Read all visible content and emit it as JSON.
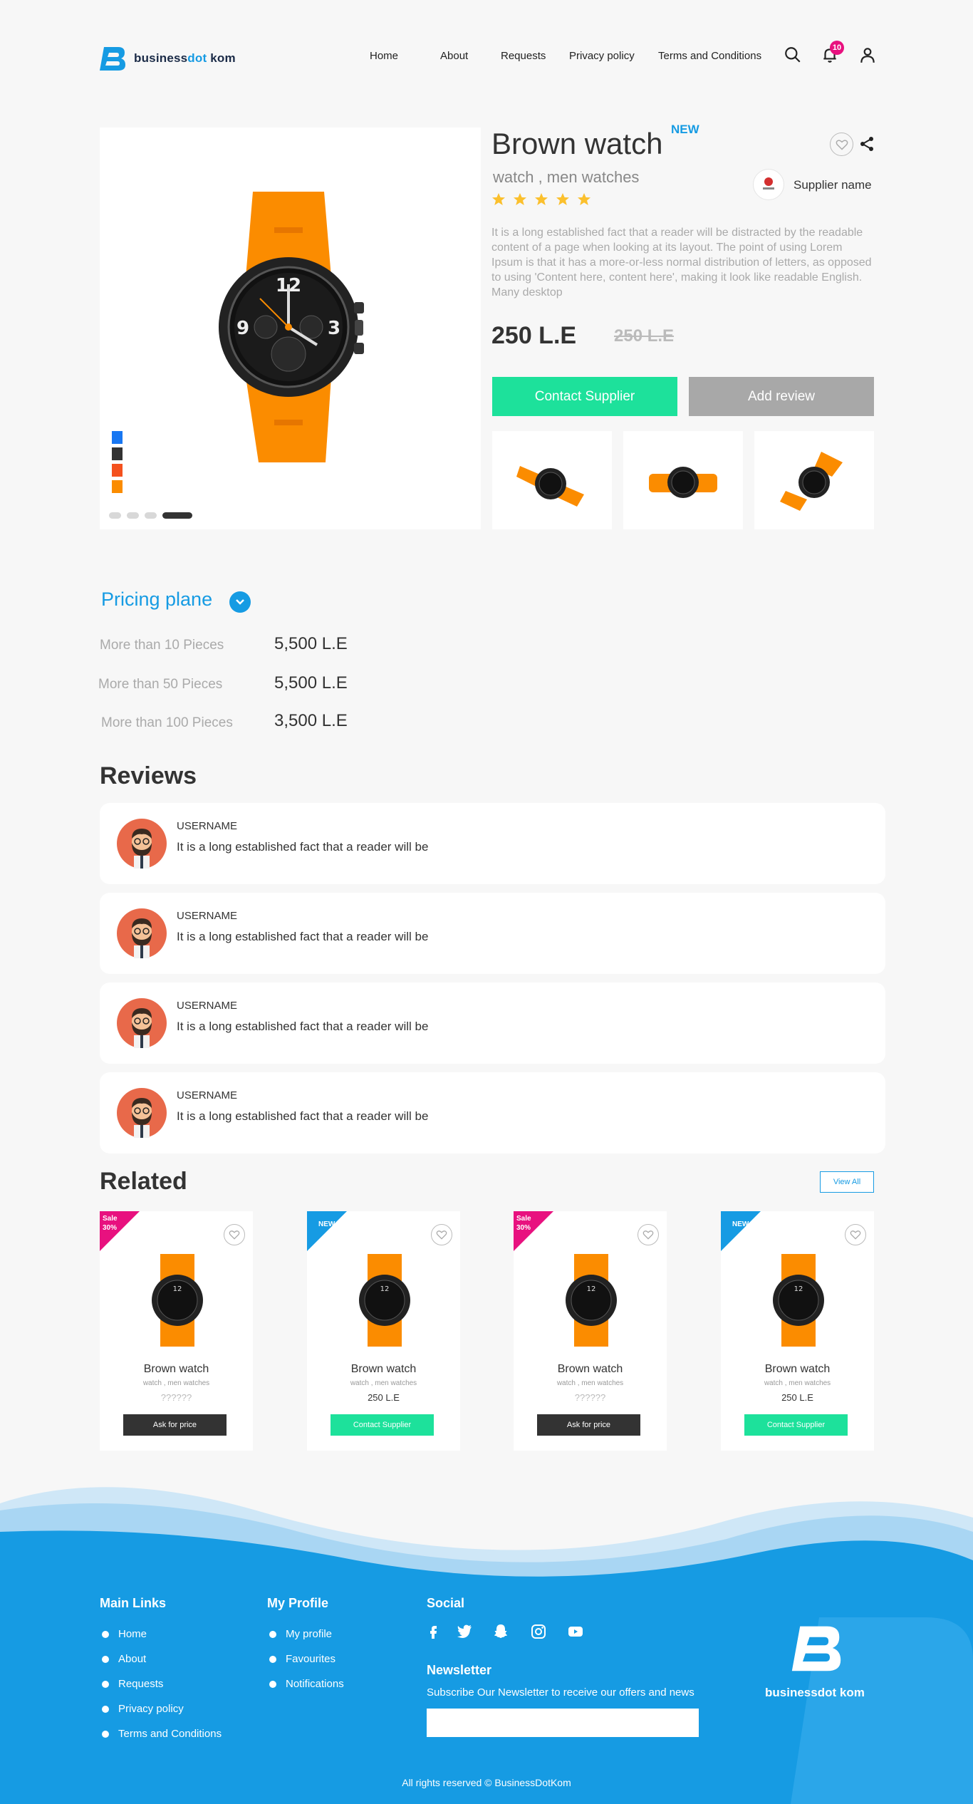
{
  "header": {
    "logo_word": "business",
    "logo_dot": "dot",
    "logo_word2": "kom",
    "nav": [
      "Home",
      "About",
      "Requests",
      "Privacy policy",
      "Terms and Conditions"
    ],
    "notification_count": "10",
    "icons": [
      "search-icon",
      "bell-icon",
      "user-icon"
    ]
  },
  "product": {
    "title": "Brown watch",
    "new_tag": "NEW",
    "subtitle": "watch , men watches",
    "rating": 5,
    "rating_max": 5,
    "supplier_name": "Supplier name",
    "description": "It is a long established fact that a reader will be distracted by the readable content of a page when looking at its layout. The point of using Lorem Ipsum is that it has a more-or-less normal distribution of letters, as opposed to using 'Content here, content here', making it look like readable English. Many desktop",
    "price": "250 L.E",
    "old_price": "250 L.E",
    "contact_label": "Contact Supplier",
    "review_label": "Add review",
    "swatches": [
      "#1877f2",
      "#333333",
      "#f4511e",
      "#fb8c00"
    ],
    "gallery_active_index": 4,
    "gallery_count": 4
  },
  "pricing": {
    "title": "Pricing plane",
    "rows": [
      {
        "label": "More than 10 Pieces",
        "value": "5,500 L.E"
      },
      {
        "label": "More than 50 Pieces",
        "value": "5,500 L.E"
      },
      {
        "label": "More than 100 Pieces",
        "value": "3,500 L.E"
      }
    ]
  },
  "reviews": {
    "title": "Reviews",
    "items": [
      {
        "user": "USERNAME",
        "text": "It is a long established fact that a reader will be"
      },
      {
        "user": "USERNAME",
        "text": "It is a long established fact that a reader will be"
      },
      {
        "user": "USERNAME",
        "text": "It is a long established fact that a reader will be"
      },
      {
        "user": "USERNAME",
        "text": "It is a long established fact that a reader will be"
      }
    ]
  },
  "related": {
    "title": "Related",
    "view_all": "View All",
    "items": [
      {
        "tag": "Sale",
        "tag_value": "30%",
        "tag_color": "#e8117f",
        "title": "Brown watch",
        "sub": "watch , men watches",
        "price": "??????",
        "button": "Ask for price",
        "button_color": "#333333"
      },
      {
        "tag": "NEW",
        "tag_value": "",
        "tag_color": "#169be3",
        "title": "Brown watch",
        "sub": "watch , men watches",
        "price": "250 L.E",
        "button": "Contact Supplier",
        "button_color": "#1de19b"
      },
      {
        "tag": "Sale",
        "tag_value": "30%",
        "tag_color": "#e8117f",
        "title": "Brown watch",
        "sub": "watch , men watches",
        "price": "??????",
        "button": "Ask for price",
        "button_color": "#333333"
      },
      {
        "tag": "NEW",
        "tag_value": "",
        "tag_color": "#169be3",
        "title": "Brown watch",
        "sub": "watch , men watches",
        "price": "250 L.E",
        "button": "Contact Supplier",
        "button_color": "#1de19b"
      }
    ]
  },
  "footer": {
    "main_links_title": "Main Links",
    "main_links": [
      "Home",
      "About",
      "Requests",
      "Privacy policy",
      "Terms and Conditions"
    ],
    "profile_title": "My Profile",
    "profile_links": [
      "My profile",
      "Favourites",
      "Notifications"
    ],
    "social_title": "Social",
    "social_icons": [
      "facebook-icon",
      "twitter-icon",
      "snapchat-icon",
      "instagram-icon",
      "youtube-icon"
    ],
    "newsletter_title": "Newsletter",
    "newsletter_text": "Subscribe Our Newsletter to receive our offers and news",
    "newsletter_placeholder": "",
    "logo_word": "business",
    "logo_dot": "dot",
    "logo_word2": "kom",
    "copyright": "All rights reserved © BusinessDotKom"
  },
  "colors": {
    "brand_blue": "#169be3",
    "green": "#1de19b",
    "pink": "#e8117f",
    "orange": "#fb8c00",
    "star": "#fbc02d"
  }
}
